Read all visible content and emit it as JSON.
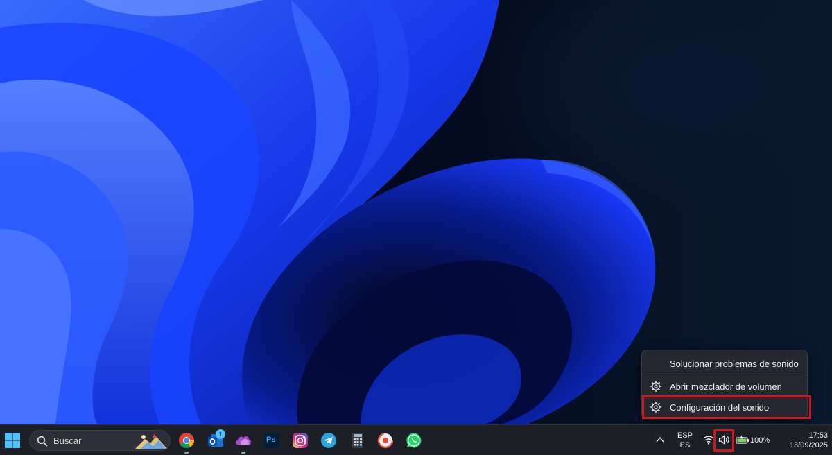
{
  "context_menu": {
    "items": [
      {
        "label": "Solucionar problemas de sonido",
        "icon": ""
      },
      {
        "label": "Abrir mezclador de volumen",
        "icon": "gear-icon"
      },
      {
        "label": "Configuración del sonido",
        "icon": "gear-icon",
        "highlighted": true
      }
    ]
  },
  "taskbar": {
    "search": {
      "placeholder": "Buscar"
    },
    "apps": [
      {
        "name": "chrome-icon",
        "running": true
      },
      {
        "name": "outlook-icon",
        "badge": "1",
        "running": false
      },
      {
        "name": "onedrive-icon",
        "running": true
      },
      {
        "name": "photoshop-icon",
        "label": "Ps",
        "running": false
      },
      {
        "name": "instagram-icon",
        "running": false
      },
      {
        "name": "telegram-icon",
        "running": false
      },
      {
        "name": "calculator-icon",
        "running": false
      },
      {
        "name": "screen-recorder-icon",
        "running": false
      },
      {
        "name": "whatsapp-icon",
        "running": false
      }
    ],
    "tray": {
      "language_line1": "ESP",
      "language_line2": "ES",
      "battery_percent": "100%",
      "time": "17:53",
      "date": "13/09/2025"
    }
  },
  "colors": {
    "highlight": "#d0161f",
    "taskbar_bg": "#1c1f26",
    "menu_bg": "#252830",
    "wallpaper_blue": "#1a3bff"
  }
}
